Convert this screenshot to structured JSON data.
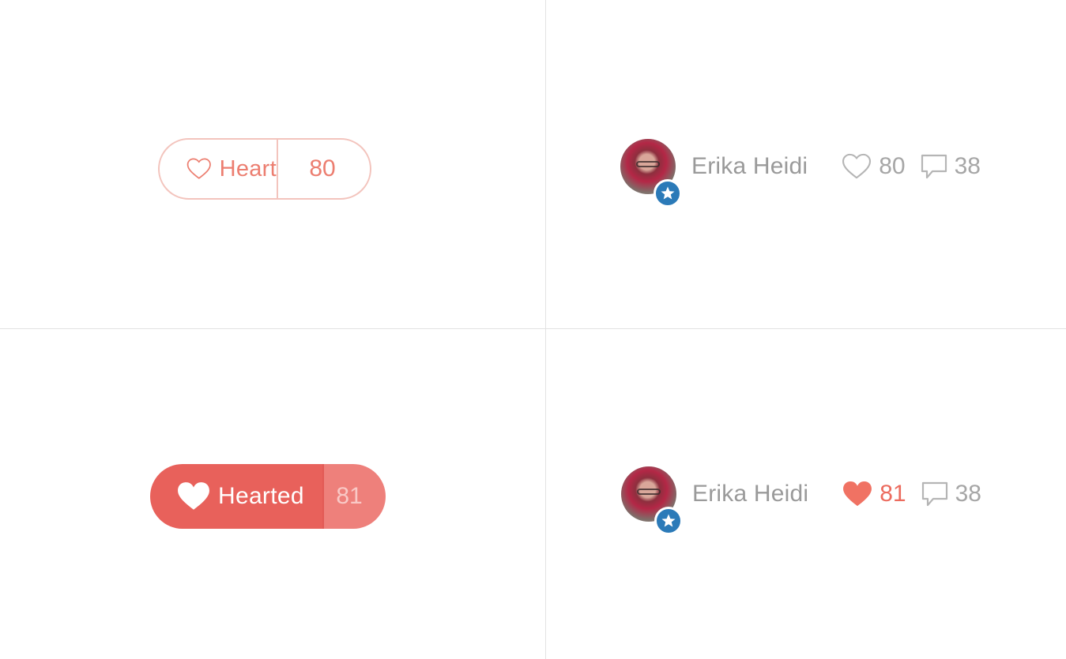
{
  "heart_button": {
    "label": "Heart",
    "count": "80",
    "icon": "heart-outline-icon",
    "state": "outline"
  },
  "hearted_button": {
    "label": "Hearted",
    "count": "81",
    "icon": "heart-filled-icon",
    "state": "filled"
  },
  "author_rows": [
    {
      "name": "Erika Heidi",
      "avatar_badge_icon": "star-icon",
      "hearts": "80",
      "hearts_icon": "heart-outline-icon",
      "comments": "38",
      "comments_icon": "comment-icon"
    },
    {
      "name": "Erika Heidi",
      "avatar_badge_icon": "star-icon",
      "hearts": "81",
      "hearts_icon": "heart-filled-icon",
      "comments": "38",
      "comments_icon": "comment-icon"
    }
  ],
  "colors": {
    "accent": "#e8615b",
    "accent_light": "#ee807b",
    "outline": "#f3c4bd",
    "text_accent": "#ec7e70",
    "muted_text": "#9a9a9a",
    "badge": "#2b7ab8",
    "divider": "#e2e2e2"
  }
}
